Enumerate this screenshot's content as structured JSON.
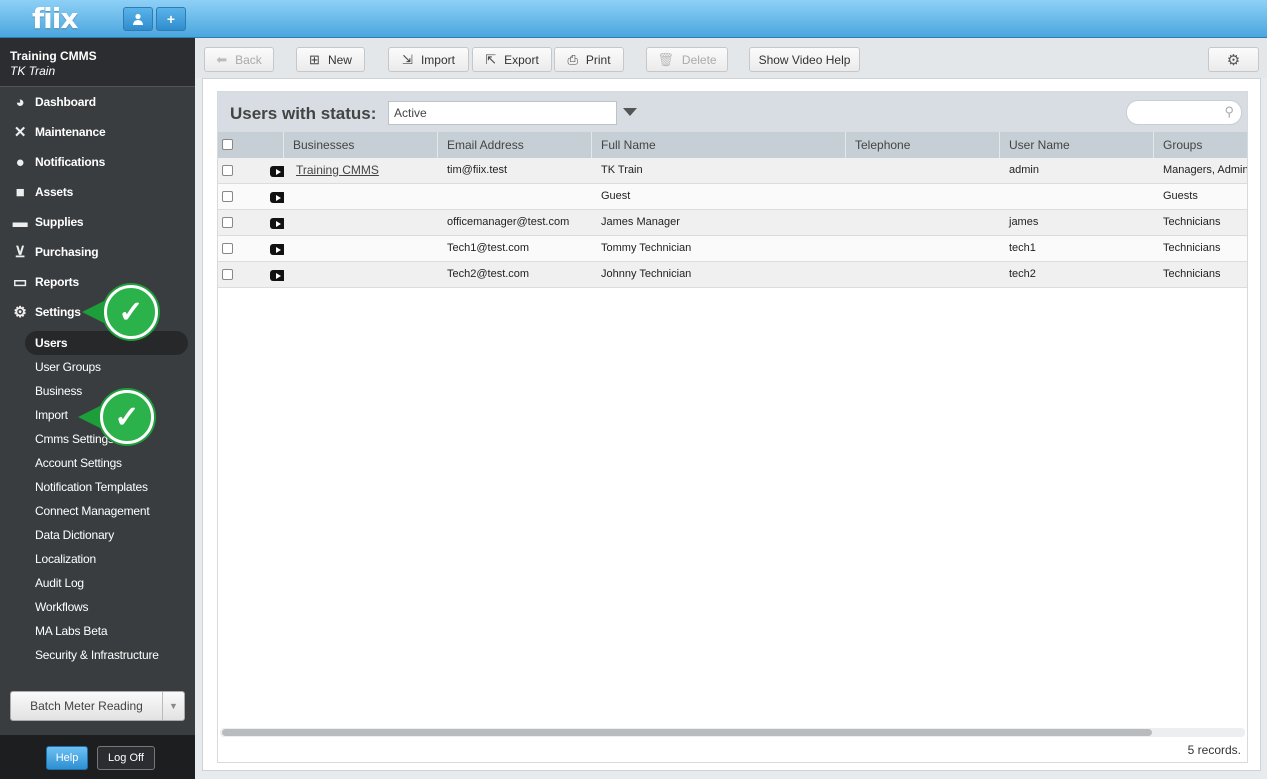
{
  "app": {
    "logo": "fiix"
  },
  "topbar": {
    "user_icon": "user-icon",
    "add_icon": "plus-icon"
  },
  "sidebar": {
    "company": "Training CMMS",
    "user": "TK Train",
    "nav": [
      {
        "label": "Dashboard",
        "icon": "dashboard-icon"
      },
      {
        "label": "Maintenance",
        "icon": "tools-icon"
      },
      {
        "label": "Notifications",
        "icon": "chat-bubble-icon"
      },
      {
        "label": "Assets",
        "icon": "boxes-icon"
      },
      {
        "label": "Supplies",
        "icon": "truck-icon"
      },
      {
        "label": "Purchasing",
        "icon": "cart-icon"
      },
      {
        "label": "Reports",
        "icon": "chart-icon"
      },
      {
        "label": "Settings",
        "icon": "gear-icon"
      }
    ],
    "settings_items": [
      "Users",
      "User Groups",
      "Business",
      "Import",
      "Cmms Settings",
      "Account Settings",
      "Notification Templates",
      "Connect Management",
      "Data Dictionary",
      "Localization",
      "Audit Log",
      "Workflows",
      "MA Labs Beta",
      "Security & Infrastructure"
    ],
    "batch_label": "Batch Meter Reading",
    "help_label": "Help",
    "logoff_label": "Log Off"
  },
  "toolbar": {
    "back": "Back",
    "new": "New",
    "import": "Import",
    "export": "Export",
    "print": "Print",
    "delete": "Delete",
    "video_help": "Show Video Help"
  },
  "filter": {
    "label": "Users with status:",
    "status_value": "Active",
    "search_placeholder": ""
  },
  "table": {
    "columns": [
      "Businesses",
      "Email Address",
      "Full Name",
      "Telephone",
      "User Name",
      "Groups"
    ],
    "rows": [
      {
        "business": "Training CMMS",
        "email": "tim@fiix.test",
        "full_name": "TK Train",
        "telephone": "",
        "user_name": "admin",
        "groups": "Managers, Administrators"
      },
      {
        "business": "",
        "email": "",
        "full_name": "Guest",
        "telephone": "",
        "user_name": "",
        "groups": "Guests"
      },
      {
        "business": "",
        "email": "officemanager@test.com",
        "full_name": "James Manager",
        "telephone": "",
        "user_name": "james",
        "groups": "Technicians"
      },
      {
        "business": "",
        "email": "Tech1@test.com",
        "full_name": "Tommy Technician",
        "telephone": "",
        "user_name": "tech1",
        "groups": "Technicians"
      },
      {
        "business": "",
        "email": "Tech2@test.com",
        "full_name": "Johnny Technician",
        "telephone": "",
        "user_name": "tech2",
        "groups": "Technicians"
      }
    ],
    "record_count": "5 records."
  },
  "colors": {
    "accent": "#4aa6de",
    "sidebar": "#3a3d40",
    "callout": "#2bb24a"
  }
}
